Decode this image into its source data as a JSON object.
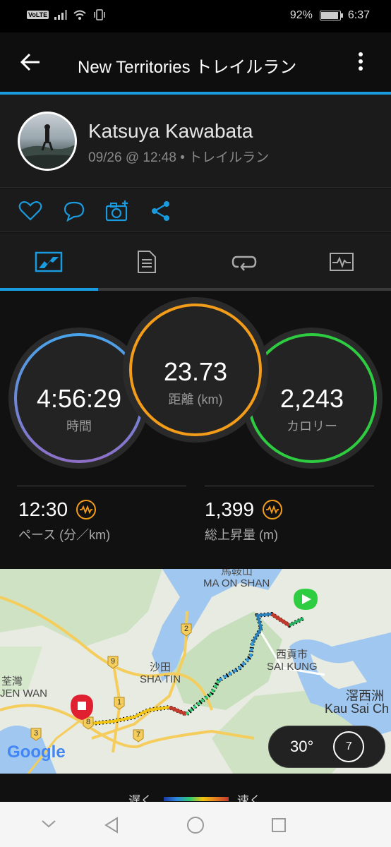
{
  "status_bar": {
    "volte": "VoLTE",
    "battery": "92%",
    "time": "6:37"
  },
  "app_bar": {
    "title": "New Territories トレイルラン"
  },
  "profile": {
    "name": "Katsuya Kawabata",
    "subtitle": "09/26 @ 12:48 • トレイルラン"
  },
  "actions": [
    "like-icon",
    "comment-icon",
    "add-photo-icon",
    "share-icon"
  ],
  "tabs": [
    "overview-tab",
    "details-tab",
    "laps-tab",
    "charts-tab"
  ],
  "stats": {
    "time": {
      "value": "4:56:29",
      "label": "時間"
    },
    "distance": {
      "value": "23.73",
      "label": "距離 (km)"
    },
    "calories": {
      "value": "2,243",
      "label": "カロリー"
    }
  },
  "metrics": {
    "pace": {
      "value": "12:30",
      "label": "ペース (分／km)"
    },
    "ascent": {
      "value": "1,399",
      "label": "総上昇量 (m)"
    }
  },
  "map": {
    "labels": {
      "ma_on_shan_cjk": "馬鞍山",
      "ma_on_shan": "MA ON SHAN",
      "sai_kung_cjk": "西貢市",
      "sai_kung": "SAI KUNG",
      "sha_tin_cjk": "沙田",
      "sha_tin": "SHA TIN",
      "tsuen_wan_cjk": "荃灣",
      "tsuen_wan": "JEN WAN",
      "kau_sai_cjk": "滘西洲",
      "kau_sai": "Kau Sai Ch",
      "route_2": "2",
      "route_9": "9",
      "route_1": "1",
      "route_7": "7",
      "route_3": "3",
      "route_8": "8"
    },
    "google": "Google",
    "temperature": "30°",
    "wind": "7"
  },
  "legend": {
    "slow": "遅く",
    "fast": "速く"
  },
  "colors": {
    "accent": "#1a9be0",
    "time_ring": "#4f8fd8",
    "distance_ring": "#f39c1a",
    "calories_ring": "#2ecc40"
  }
}
